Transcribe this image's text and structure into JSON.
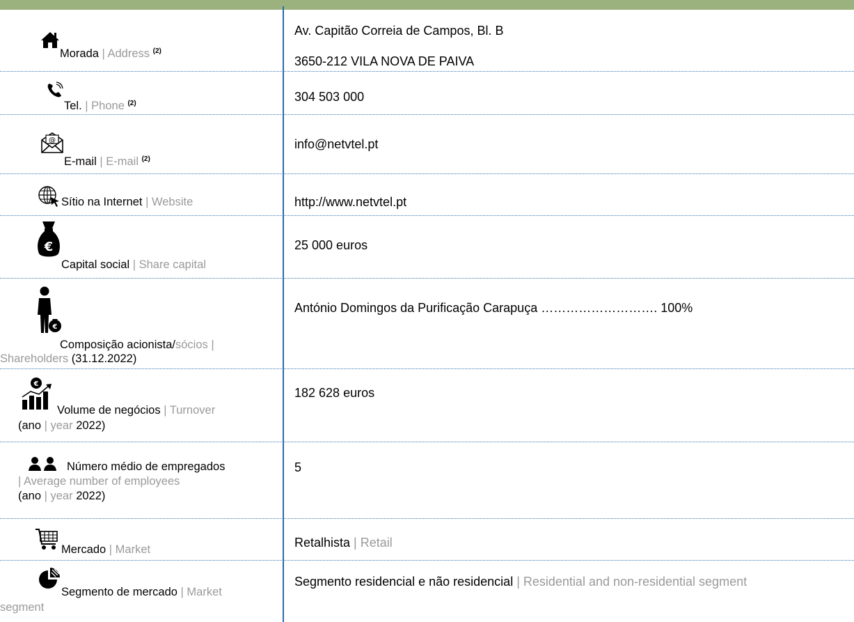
{
  "rows": [
    {
      "pt": "Morada",
      "sep": " | ",
      "en": "Address",
      "note": "(2)",
      "icon": "house-icon",
      "value_lines": [
        "Av. Capitão Correia de Campos, Bl. B",
        "3650-212 VILA NOVA DE PAIVA"
      ]
    },
    {
      "pt": "Tel.",
      "sep": " | ",
      "en": "Phone",
      "note": "(2)",
      "icon": "phone-icon",
      "value": "304 503 000"
    },
    {
      "pt": "E-mail",
      "sep": " | ",
      "en": "E-mail",
      "note": "(2)",
      "icon": "envelope-icon",
      "value": "info@netvtel.pt"
    },
    {
      "pt": "Sítio na Internet",
      "sep": " | ",
      "en": "Website",
      "icon": "globe-cursor-icon",
      "value": "http://www.netvtel.pt"
    },
    {
      "pt": "Capital social",
      "sep": " | ",
      "en": "Share capital",
      "icon": "money-bag-icon",
      "value": "25 000 euros"
    },
    {
      "pt": "Composição acionista/",
      "en_a": "sócios |",
      "en_b": "Shareholders",
      "date": " (31.12.2022)",
      "icon": "shareholder-icon",
      "value": "António Domingos da Purificação Carapuça ………………………. 100%"
    },
    {
      "pt": "Volume de negócios",
      "sep": " | ",
      "en": "Turnover",
      "ano": " (ano",
      "sep2": " | ",
      "year": "year",
      "yr": " 2022)",
      "icon": "turnover-chart-icon",
      "value": "182 628 euros"
    },
    {
      "pt": "Número médio de empregados",
      "en": "| Average number of employees",
      "ano": "(ano",
      "sep2": " | ",
      "year": "year",
      "yr": " 2022)",
      "icon": "employees-icon",
      "value": "5"
    },
    {
      "pt": "Mercado",
      "sep": " | ",
      "en": "Market",
      "icon": "cart-icon",
      "value_pt": "Retalhista",
      "value_sep": " | ",
      "value_en": "Retail"
    },
    {
      "pt": "Segmento de mercado",
      "sep": " | ",
      "en": "Market",
      "en2": "segment",
      "icon": "pie-chart-icon",
      "value_pt": "Segmento residencial e não residencial",
      "value_sep": " | ",
      "value_en": "Residential and non-residential segment"
    }
  ],
  "colors": {
    "topbar": "#9cb27e",
    "divider": "#2a6aa6",
    "english_text": "#9a9a9a"
  }
}
